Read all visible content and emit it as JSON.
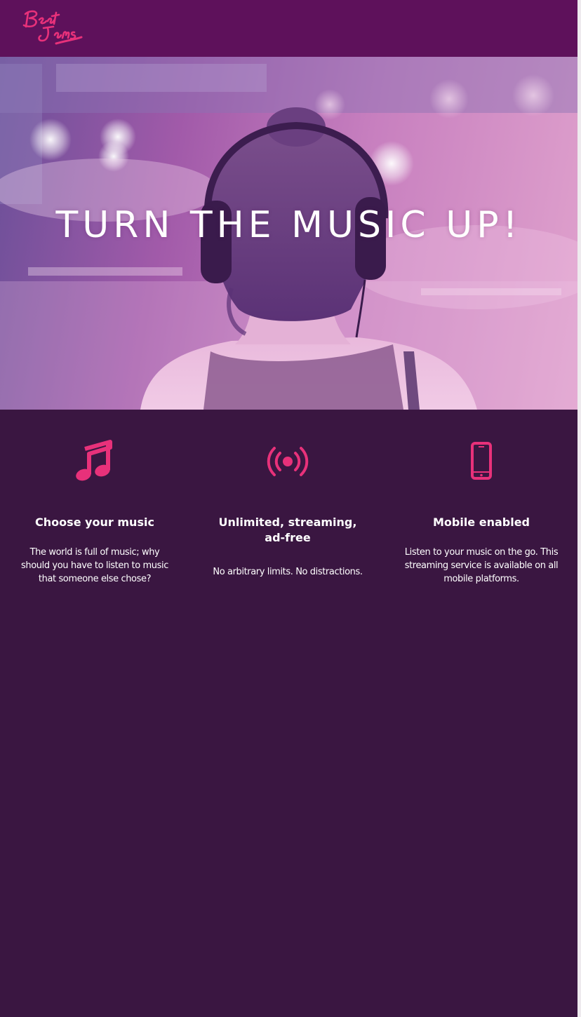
{
  "header": {
    "logo_text": "Beat Jams",
    "logo_color": "#e8317a",
    "background": "#5e115b"
  },
  "hero": {
    "title": "TURN THE MUSIC UP!"
  },
  "features": [
    {
      "icon": "music-note-icon",
      "title": "Choose your music",
      "text": "The world is full of music; why should you have to listen to music that someone else chose?"
    },
    {
      "icon": "broadcast-icon",
      "title": "Unlimited, streaming, ad-free",
      "text": "No arbitrary limits. No distractions."
    },
    {
      "icon": "mobile-phone-icon",
      "title": "Mobile enabled",
      "text": "Listen to your music on the go. This streaming service is available on all mobile platforms."
    }
  ],
  "colors": {
    "accent": "#e8317a",
    "page_background": "#3a1641"
  }
}
